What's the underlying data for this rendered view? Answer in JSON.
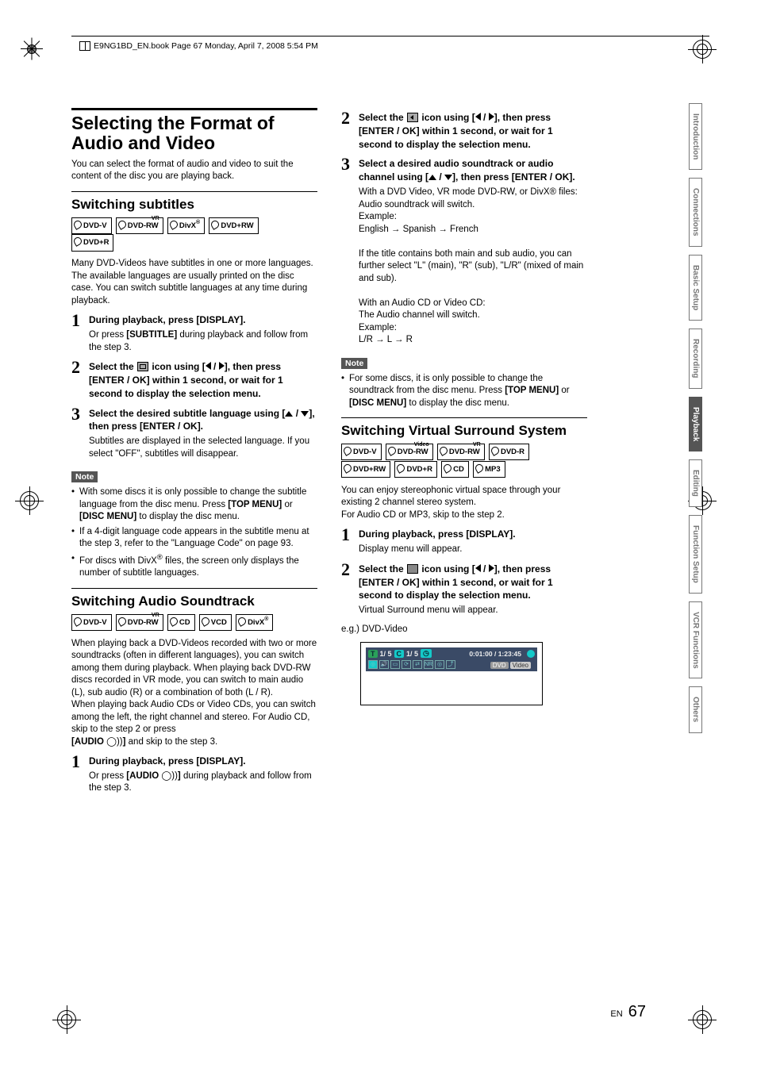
{
  "header": {
    "text": "E9NG1BD_EN.book  Page 67  Monday, April 7, 2008  5:54 PM"
  },
  "title": "Selecting the Format of Audio and Video",
  "intro": "You can select the format of audio and video to suit the content of the disc you are playing back.",
  "subtitles": {
    "heading": "Switching subtitles",
    "badges": [
      "DVD-V",
      "DVD-RW VR",
      "DivX®",
      "DVD+RW",
      "DVD+R"
    ],
    "body": "Many DVD-Videos have subtitles in one or more languages. The available languages are usually printed on the disc case. You can switch subtitle languages at any time during playback.",
    "steps": [
      {
        "head": "During playback, press [DISPLAY].",
        "body": "Or press [SUBTITLE] during playback and follow from the step 3."
      },
      {
        "head_a": "Select the ",
        "head_b": " icon using [",
        "head_c": "], then press [ENTER / OK] within 1 second, or wait for 1 second to display the selection menu."
      },
      {
        "head": "Select the desired subtitle language using [▲ / ▼], then press [ENTER / OK].",
        "body": "Subtitles are displayed in the selected language. If you select \"OFF\", subtitles will disappear."
      }
    ],
    "note_label": "Note",
    "notes": [
      "With some discs it is only possible to change the subtitle language from the disc menu. Press [TOP MENU] or [DISC MENU] to display the disc menu.",
      "If a 4-digit language code appears in the subtitle menu at the step 3, refer to the \"Language Code\" on page 93.",
      "For discs with DivX® files, the screen only displays the number of subtitle languages."
    ]
  },
  "audio": {
    "heading": "Switching Audio Soundtrack",
    "badges": [
      "DVD-V",
      "DVD-RW VR",
      "CD",
      "VCD",
      "DivX®"
    ],
    "body": "When playing back a DVD-Videos recorded with two or more soundtracks (often in different languages), you can switch among them during playback. When playing back DVD-RW discs recorded in VR mode, you can switch to main audio (L), sub audio (R) or a combination of both (L / R). When playing back Audio CDs or Video CDs, you can switch among the left, the right channel and stereo. For Audio CD, skip to the step 2 or press [AUDIO ⦾] and skip to the step 3.",
    "steps": [
      {
        "head": "During playback, press [DISPLAY].",
        "body": "Or press [AUDIO ⦾] during playback and follow from the step 3."
      }
    ]
  },
  "col2": {
    "steps2": {
      "head_a": "Select the ",
      "head_b": " icon using [",
      "head_c": "], then press [ENTER / OK] within 1 second, or wait for 1 second to display the selection menu."
    },
    "steps3head": "Select a desired audio soundtrack or audio channel using [▲ / ▼], then press [ENTER / OK].",
    "s3a": "With a DVD Video, VR mode DVD-RW, or DivX® files:",
    "s3b": "Audio soundtrack will switch.",
    "s3c": "Example:",
    "s3d": "English → Spanish → French",
    "s3e": "If the title contains both main and sub audio, you can further select \"L\" (main), \"R\" (sub), \"L/R\" (mixed of main and sub).",
    "s3f": "With an Audio CD or Video CD:",
    "s3g": "The Audio channel will switch.",
    "s3h": "Example:",
    "s3i": "L/R → L → R",
    "note_label": "Note",
    "note1": "For some discs, it is only possible to change the soundtrack from the disc menu. Press [TOP MENU] or [DISC MENU] to display the disc menu."
  },
  "vsur": {
    "heading": "Switching Virtual Surround System",
    "badges1": [
      "DVD-V",
      "DVD-RW Video",
      "DVD-RW VR",
      "DVD-R"
    ],
    "badges2": [
      "DVD+RW",
      "DVD+R",
      "CD",
      "MP3"
    ],
    "body": "You can enjoy stereophonic virtual space through your existing 2 channel stereo system. For Audio CD or MP3, skip to the step 2.",
    "steps": [
      {
        "head": "During playback, press [DISPLAY].",
        "body": "Display menu will appear."
      },
      {
        "head_a": "Select the ",
        "head_b": " icon using [",
        "head_c": "], then press [ENTER / OK] within 1 second, or wait for 1 second to display the selection menu.",
        "body": "Virtual Surround menu will appear."
      }
    ],
    "eglabel": "e.g.) DVD-Video",
    "osd": {
      "t": "1/  5",
      "c": "1/  5",
      "time": "0:01:00 / 1:23:45",
      "dvd": "DVD",
      "video": "Video"
    }
  },
  "tabs": [
    "Introduction",
    "Connections",
    "Basic Setup",
    "Recording",
    "Playback",
    "Editing",
    "Function Setup",
    "VCR Functions",
    "Others"
  ],
  "active_tab": 4,
  "footer": {
    "lang": "EN",
    "page": "67"
  },
  "chart_data": {
    "type": "table",
    "note": "no chart present"
  }
}
